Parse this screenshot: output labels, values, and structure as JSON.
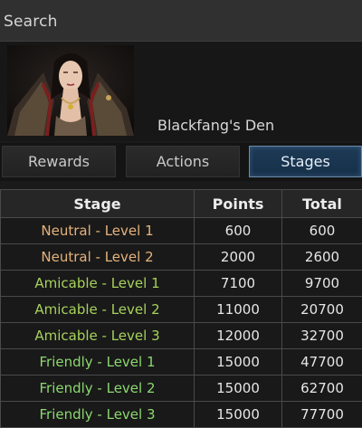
{
  "search": {
    "label": "Search"
  },
  "header": {
    "name": "Blackfang's Den"
  },
  "tabs": [
    {
      "label": "Rewards"
    },
    {
      "label": "Actions"
    },
    {
      "label": "Stages",
      "active": true
    }
  ],
  "table": {
    "headers": [
      "Stage",
      "Points",
      "Total"
    ],
    "rows": [
      {
        "stage": "Neutral - Level 1",
        "points": "600",
        "total": "600",
        "tier": "neutral"
      },
      {
        "stage": "Neutral - Level 2",
        "points": "2000",
        "total": "2600",
        "tier": "neutral"
      },
      {
        "stage": "Amicable - Level 1",
        "points": "7100",
        "total": "9700",
        "tier": "amicable"
      },
      {
        "stage": "Amicable - Level 2",
        "points": "11000",
        "total": "20700",
        "tier": "amicable"
      },
      {
        "stage": "Amicable - Level 3",
        "points": "12000",
        "total": "32700",
        "tier": "amicable"
      },
      {
        "stage": "Friendly - Level 1",
        "points": "15000",
        "total": "47700",
        "tier": "friendly"
      },
      {
        "stage": "Friendly - Level 2",
        "points": "15000",
        "total": "62700",
        "tier": "friendly"
      },
      {
        "stage": "Friendly - Level 3",
        "points": "15000",
        "total": "77700",
        "tier": "friendly"
      }
    ]
  },
  "colors": {
    "neutral": "#e5b27b",
    "amicable": "#a6d25b",
    "friendly": "#8bd86f",
    "active_tab": "#1d3a56"
  }
}
